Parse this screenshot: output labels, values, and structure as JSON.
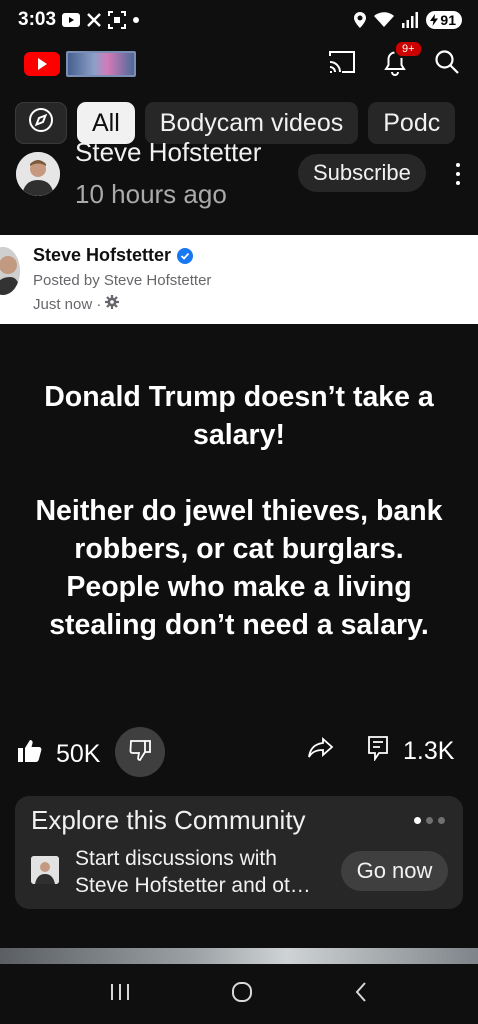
{
  "status_bar": {
    "time": "3:03",
    "battery": "91",
    "icons": [
      "youtube-notification-icon",
      "x-notification-icon",
      "screenshot-icon",
      "dot-icon",
      "location-icon",
      "wifi-icon",
      "signal-icon",
      "battery-icon"
    ]
  },
  "header": {
    "notification_badge": "9+",
    "icons": [
      "youtube-logo-icon",
      "cast-icon",
      "bell-icon",
      "search-icon"
    ]
  },
  "chips": [
    {
      "label": "All",
      "active": true
    },
    {
      "label": "Bodycam videos",
      "active": false
    },
    {
      "label": "Podc",
      "active": false
    }
  ],
  "channel": {
    "name": "Steve Hofstetter",
    "time_ago": "10 hours ago",
    "subscribe_label": "Subscribe"
  },
  "embedded_post": {
    "author": "Steve Hofstetter",
    "posted_by": "Posted by Steve Hofstetter",
    "time": "Just now ·"
  },
  "post": {
    "paragraph1": [
      "Donald Trump doesn’t take a",
      "salary!"
    ],
    "paragraph2": [
      "Neither do jewel thieves, bank",
      "robbers, or cat burglars.",
      "People who make a living",
      "stealing don’t need a salary."
    ]
  },
  "actions": {
    "likes": "50K",
    "comments": "1.3K"
  },
  "community": {
    "title": "Explore this Community",
    "desc_line1": "Start discussions with",
    "desc_line2": "Steve Hofstetter and ot…",
    "button_label": "Go now",
    "pager_active_index": 0
  },
  "colors": {
    "background": "#0f0f0f",
    "accent_red": "#ff0000",
    "chip_bg": "#272727",
    "verified_blue": "#1877f2"
  }
}
